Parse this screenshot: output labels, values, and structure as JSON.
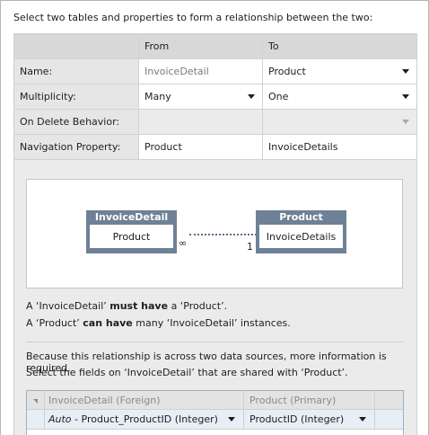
{
  "instruction": "Select two tables and properties to form a relationship between the two:",
  "grid": {
    "headers": [
      "",
      "From",
      "To"
    ],
    "rows": [
      {
        "label": "Name:",
        "from": "InvoiceDetail",
        "to": "Product"
      },
      {
        "label": "Multiplicity:",
        "from": "Many",
        "to": "One"
      },
      {
        "label": "On Delete Behavior:",
        "from": "",
        "to": ""
      },
      {
        "label": "Navigation Property:",
        "from": "Product",
        "to": "InvoiceDetails"
      }
    ]
  },
  "diagram": {
    "left_entity": {
      "title": "InvoiceDetail",
      "property": "Product"
    },
    "right_entity": {
      "title": "Product",
      "property": "InvoiceDetails"
    },
    "left_multiplicity": "∞",
    "right_multiplicity": "1"
  },
  "statements": {
    "line1": {
      "a": "A ‘InvoiceDetail’ ",
      "b": "must have",
      "c": " a ‘Product’."
    },
    "line2": {
      "a": "A ‘Product’ ",
      "b": "can have",
      "c": " many ‘InvoiceDetail’ instances."
    }
  },
  "note": {
    "line1": "Because this relationship is across two data sources, more information is required.",
    "line2": "Select the fields on ‘InvoiceDetail’ that are shared with ‘Product’."
  },
  "mapping": {
    "header_foreign": "InvoiceDetail (Foreign)",
    "header_primary": "Product (Primary)",
    "row": {
      "auto": "Auto",
      "foreign": " - Product_ProductID (Integer)",
      "primary": "ProductID (Integer)"
    }
  }
}
